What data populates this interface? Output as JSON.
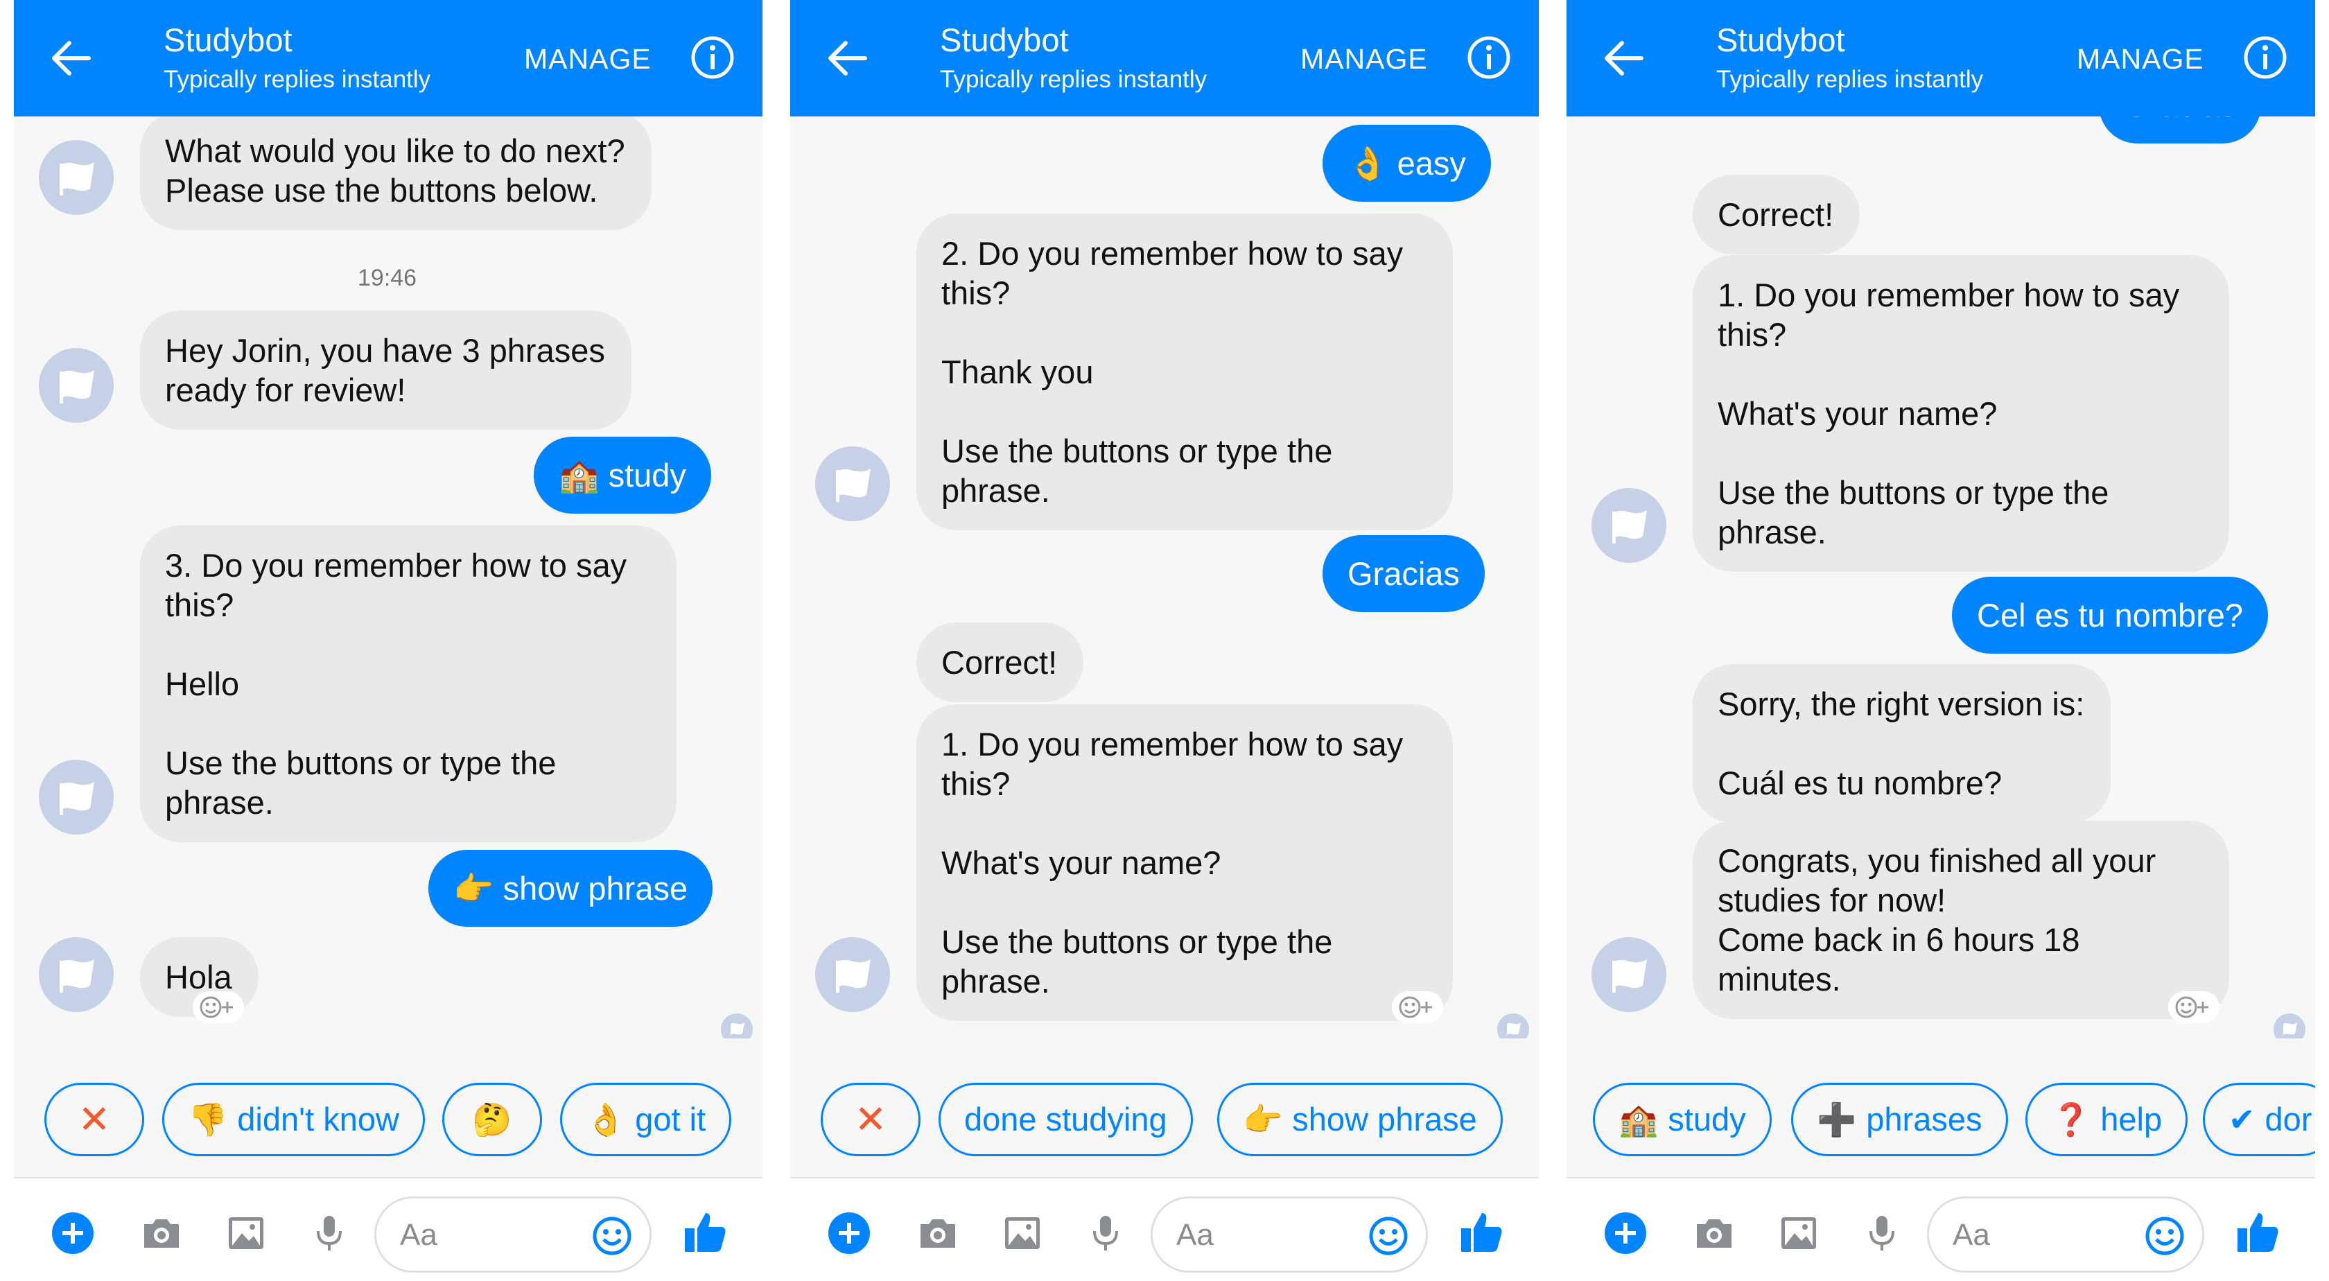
{
  "colors": {
    "accent": "#0084ff",
    "bot_bubble": "#e9e9e9",
    "avatar": "#c6d0e7",
    "cancel": "#f35a2a"
  },
  "header": {
    "title": "Studybot",
    "subtitle": "Typically replies instantly",
    "manage_label": "MANAGE",
    "back_icon": "arrow-left-icon",
    "info_icon": "info-icon"
  },
  "composer": {
    "placeholder": "Aa",
    "icons": [
      "plus-icon",
      "camera-icon",
      "image-icon",
      "microphone-icon",
      "emoji-icon",
      "thumbs-up-icon"
    ]
  },
  "panels": [
    {
      "messages": [
        {
          "from": "bot",
          "text": "What would you like to do next?\nPlease use the buttons below."
        },
        {
          "from": "time",
          "text": "19:46"
        },
        {
          "from": "bot",
          "text": "Hey Jorin, you have 3 phrases\nready for review!"
        },
        {
          "from": "user",
          "text": "study",
          "emoji": "🏫"
        },
        {
          "from": "bot",
          "text": "3. Do you remember how to say\nthis?\n\nHello\n\nUse the buttons or type the\nphrase."
        },
        {
          "from": "user",
          "text": "show phrase",
          "emoji": "👉"
        },
        {
          "from": "bot",
          "text": "Hola"
        }
      ],
      "quick_replies": [
        {
          "label": "",
          "icon": "close-icon",
          "symbol": "✕"
        },
        {
          "label": "didn't know",
          "icon": "thumbs-down-icon",
          "symbol": "👎"
        },
        {
          "label": "",
          "icon": "thinking-face-icon",
          "symbol": "🤔"
        },
        {
          "label": "got it",
          "icon": "ok-hand-icon",
          "symbol": "👌"
        }
      ]
    },
    {
      "messages": [
        {
          "from": "user",
          "text": "easy",
          "emoji": "👌"
        },
        {
          "from": "bot",
          "text": "2. Do you remember how to say\nthis?\n\nThank you\n\nUse the buttons or type the\nphrase."
        },
        {
          "from": "user",
          "text": "Gracias"
        },
        {
          "from": "bot",
          "text": "Correct!"
        },
        {
          "from": "bot",
          "text": "1. Do you remember how to say\nthis?\n\nWhat's your name?\n\nUse the buttons or type the\nphrase."
        }
      ],
      "quick_replies": [
        {
          "label": "",
          "icon": "close-icon",
          "symbol": "✕"
        },
        {
          "label": "done studying",
          "icon": "",
          "symbol": ""
        },
        {
          "label": "show phrase",
          "icon": "pointing-right-icon",
          "symbol": "👉"
        }
      ]
    },
    {
      "messages": [
        {
          "from": "user",
          "text": "Gracias"
        },
        {
          "from": "bot",
          "text": "Correct!"
        },
        {
          "from": "bot",
          "text": "1. Do you remember how to say\nthis?\n\nWhat's your name?\n\nUse the buttons or type the\nphrase."
        },
        {
          "from": "user",
          "text": "Cel es tu nombre?"
        },
        {
          "from": "bot",
          "text": "Sorry, the right version is:\n\nCuál es tu nombre?"
        },
        {
          "from": "bot",
          "text": "Congrats, you finished all your\nstudies for now!\nCome back in 6 hours 18\nminutes."
        }
      ],
      "quick_replies": [
        {
          "label": "study",
          "icon": "school-icon",
          "symbol": "🏫"
        },
        {
          "label": "phrases",
          "icon": "plus-icon",
          "symbol": "➕"
        },
        {
          "label": "help",
          "icon": "question-icon",
          "symbol": "❓"
        },
        {
          "label": "dor",
          "icon": "check-icon",
          "symbol": "✔"
        }
      ]
    }
  ]
}
